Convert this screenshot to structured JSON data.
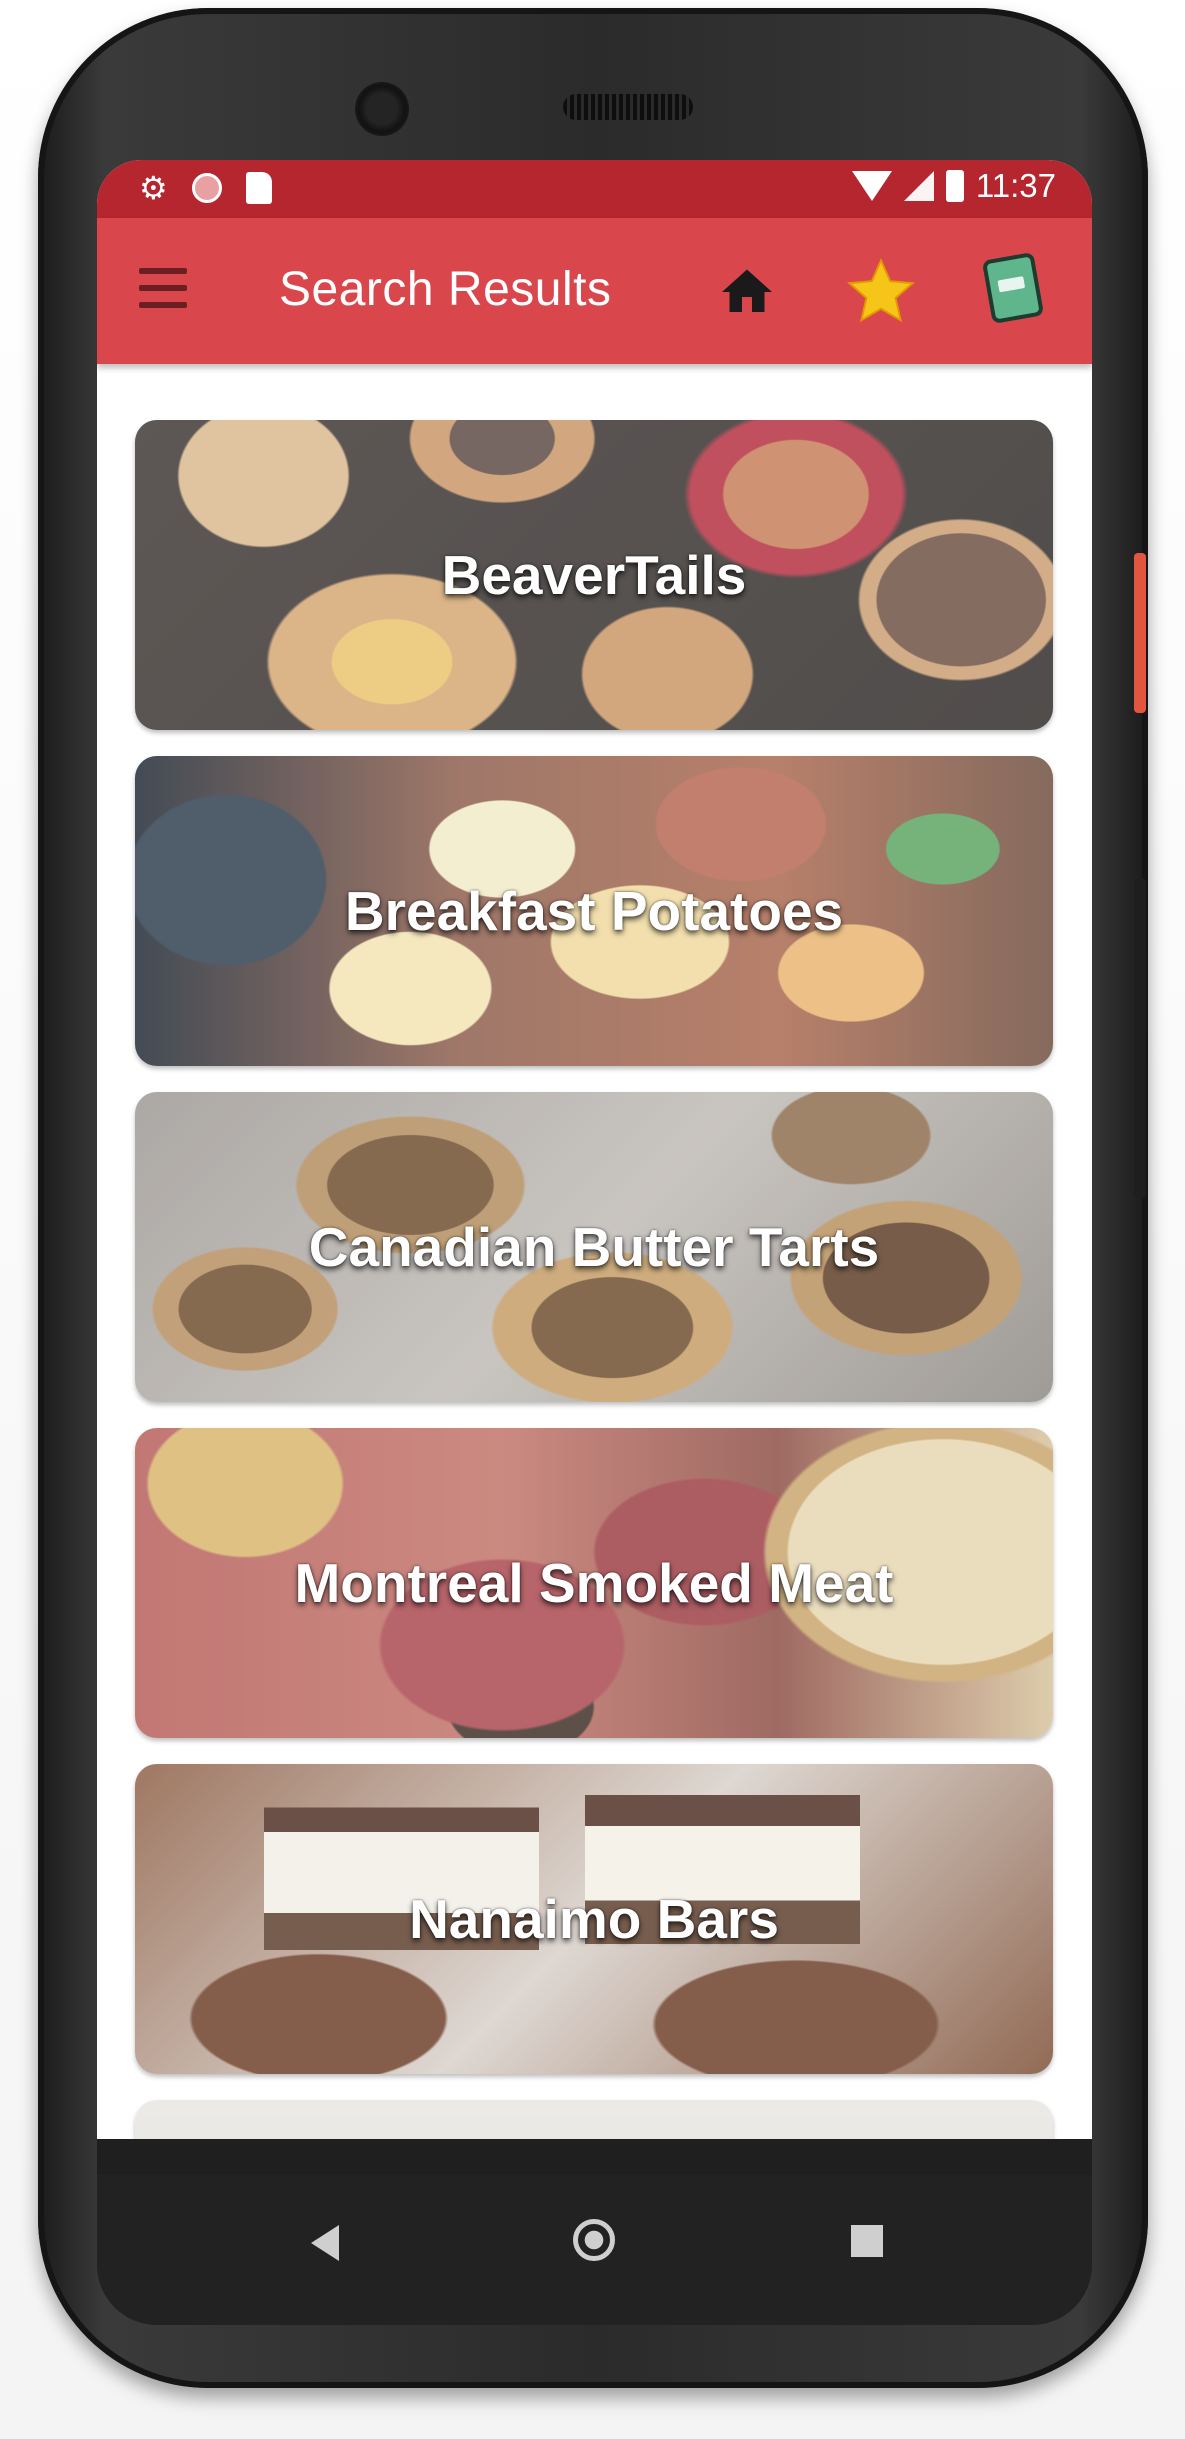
{
  "status_bar": {
    "time": "11:37",
    "left_icons": [
      "gear-icon",
      "circle-icon",
      "sd-card-icon"
    ],
    "right_icons": [
      "wifi-icon",
      "signal-icon",
      "battery-icon"
    ]
  },
  "app_bar": {
    "title": "Search Results",
    "actions": [
      "home-icon",
      "star-icon",
      "cookbook-icon"
    ],
    "color": "#d9474d",
    "status_color": "#b5262f"
  },
  "results": [
    {
      "title": "BeaverTails"
    },
    {
      "title": "Breakfast Potatoes"
    },
    {
      "title": "Canadian Butter Tarts"
    },
    {
      "title": "Montreal Smoked Meat"
    },
    {
      "title": "Nanaimo Bars"
    },
    {
      "title": ""
    }
  ],
  "nav_bar": {
    "buttons": [
      "back-icon",
      "home-circle-icon",
      "recents-icon"
    ]
  }
}
